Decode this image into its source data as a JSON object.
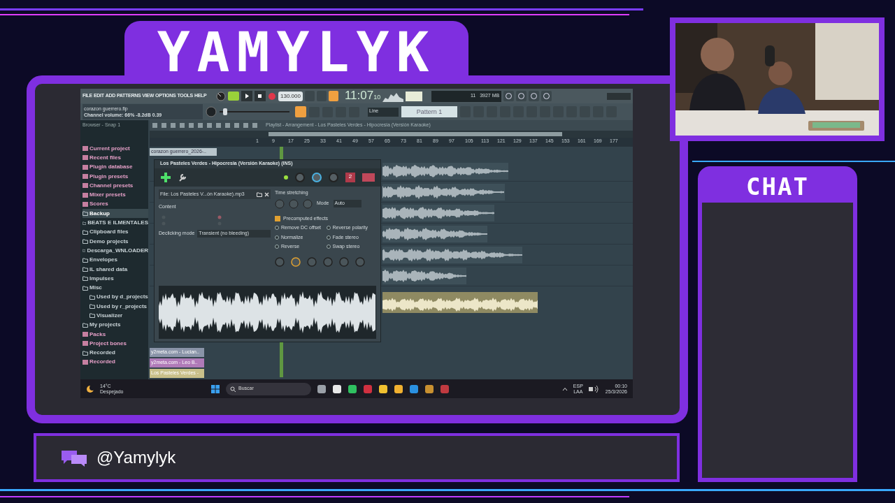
{
  "overlay": {
    "title": "YAMYLYK",
    "chat_title": "CHAT",
    "handle": "@Yamylyk"
  },
  "daw": {
    "menu": [
      "FILE",
      "EDIT",
      "ADD",
      "PATTERNS",
      "VIEW",
      "OPTIONS",
      "TOOLS",
      "HELP"
    ],
    "pitch": {
      "level": 0.05
    },
    "tempo": "130.000",
    "time": "11:07",
    "time_sub": "10",
    "hint_file": "corazon guerrero.flp",
    "hint_info": "Channel volume: 66%   -8.2dB   0.39",
    "pattern": "Pattern 1",
    "snap": "Line",
    "memory": "3927 MB",
    "cpu": "11",
    "browser": {
      "title": "Browser - Snap 1",
      "items": [
        {
          "label": "Current project",
          "kind": "special",
          "selected": false
        },
        {
          "label": "Recent files",
          "kind": "special",
          "selected": false
        },
        {
          "label": "Plugin database",
          "kind": "special",
          "selected": false
        },
        {
          "label": "Plugin presets",
          "kind": "special",
          "selected": false
        },
        {
          "label": "Channel presets",
          "kind": "special",
          "selected": false
        },
        {
          "label": "Mixer presets",
          "kind": "special",
          "selected": false
        },
        {
          "label": "Scores",
          "kind": "special",
          "selected": false
        },
        {
          "label": "Backup",
          "kind": "folder",
          "selected": true
        },
        {
          "label": "BEATS E ILMENTALES",
          "kind": "folder",
          "selected": false
        },
        {
          "label": "Clipboard files",
          "kind": "folder",
          "selected": false
        },
        {
          "label": "Demo projects",
          "kind": "folder",
          "selected": false
        },
        {
          "label": "Descarga_WNLOADER",
          "kind": "folder",
          "selected": false
        },
        {
          "label": "Envelopes",
          "kind": "folder",
          "selected": false
        },
        {
          "label": "IL shared data",
          "kind": "folder",
          "selected": false
        },
        {
          "label": "Impulses",
          "kind": "folder",
          "selected": false
        },
        {
          "label": "Misc",
          "kind": "folder",
          "selected": false,
          "children": [
            {
              "label": "Used by d_projects",
              "kind": "folder",
              "selected": false
            },
            {
              "label": "Used by r_projects",
              "kind": "folder",
              "selected": false
            },
            {
              "label": "Visualizer",
              "kind": "folder",
              "selected": false
            }
          ]
        },
        {
          "label": "My projects",
          "kind": "folder",
          "selected": false
        },
        {
          "label": "Packs",
          "kind": "special",
          "selected": false
        },
        {
          "label": "Project bones",
          "kind": "special",
          "selected": false
        },
        {
          "label": "Recorded",
          "kind": "folder",
          "selected": false
        },
        {
          "label": "Recorded",
          "kind": "special",
          "selected": false
        }
      ]
    },
    "playlist": {
      "title": "Playlist - Arrangement - Los Pasteles Verdes - Hipocresia (Versión Karaoke)",
      "top_clip": "corazon guerrero_2026-..",
      "ruler": [
        "1",
        "9",
        "17",
        "25",
        "33",
        "41",
        "49",
        "57",
        "65",
        "73",
        "81",
        "89",
        "97",
        "105",
        "113",
        "121",
        "129",
        "137",
        "145",
        "153",
        "161",
        "169",
        "177"
      ],
      "tracks": [
        {
          "label": "y2meta.com - Lucian..",
          "color": "#8a94a8"
        },
        {
          "label": "y2meta.com - Leo B..",
          "color": "#b07ab8"
        },
        {
          "label": "Los Pasteles Verdes -",
          "color": "#c9c08a"
        }
      ]
    },
    "channel_window": {
      "title": "Los Pasteles Verdes - Hipocresia (Versión Karaoke) (INS)",
      "file": "File: Los Pasteles V...ón Karaoke).mp3",
      "content": "Content",
      "declicking_label": "Declicking mode",
      "declicking": "Transient (no bleeding)",
      "time_stretching": "Time stretching",
      "mode_label": "Mode",
      "mode": "Auto",
      "precomputed": "Precomputed effects",
      "pattern_number": "2",
      "effects": [
        {
          "label": "Remove DC offset",
          "checked": false
        },
        {
          "label": "Reverse polarity",
          "checked": false
        },
        {
          "label": "Normalize",
          "checked": false
        },
        {
          "label": "Fade stereo",
          "checked": false
        },
        {
          "label": "Reverse",
          "checked": false
        },
        {
          "label": "Swap stereo",
          "checked": false
        }
      ]
    }
  },
  "taskbar": {
    "temperature": "14°C",
    "weather": "Despejado",
    "search": "Buscar",
    "lang": "ESP",
    "layout": "LAA",
    "time": "00:10",
    "date": "25/3/2026"
  }
}
